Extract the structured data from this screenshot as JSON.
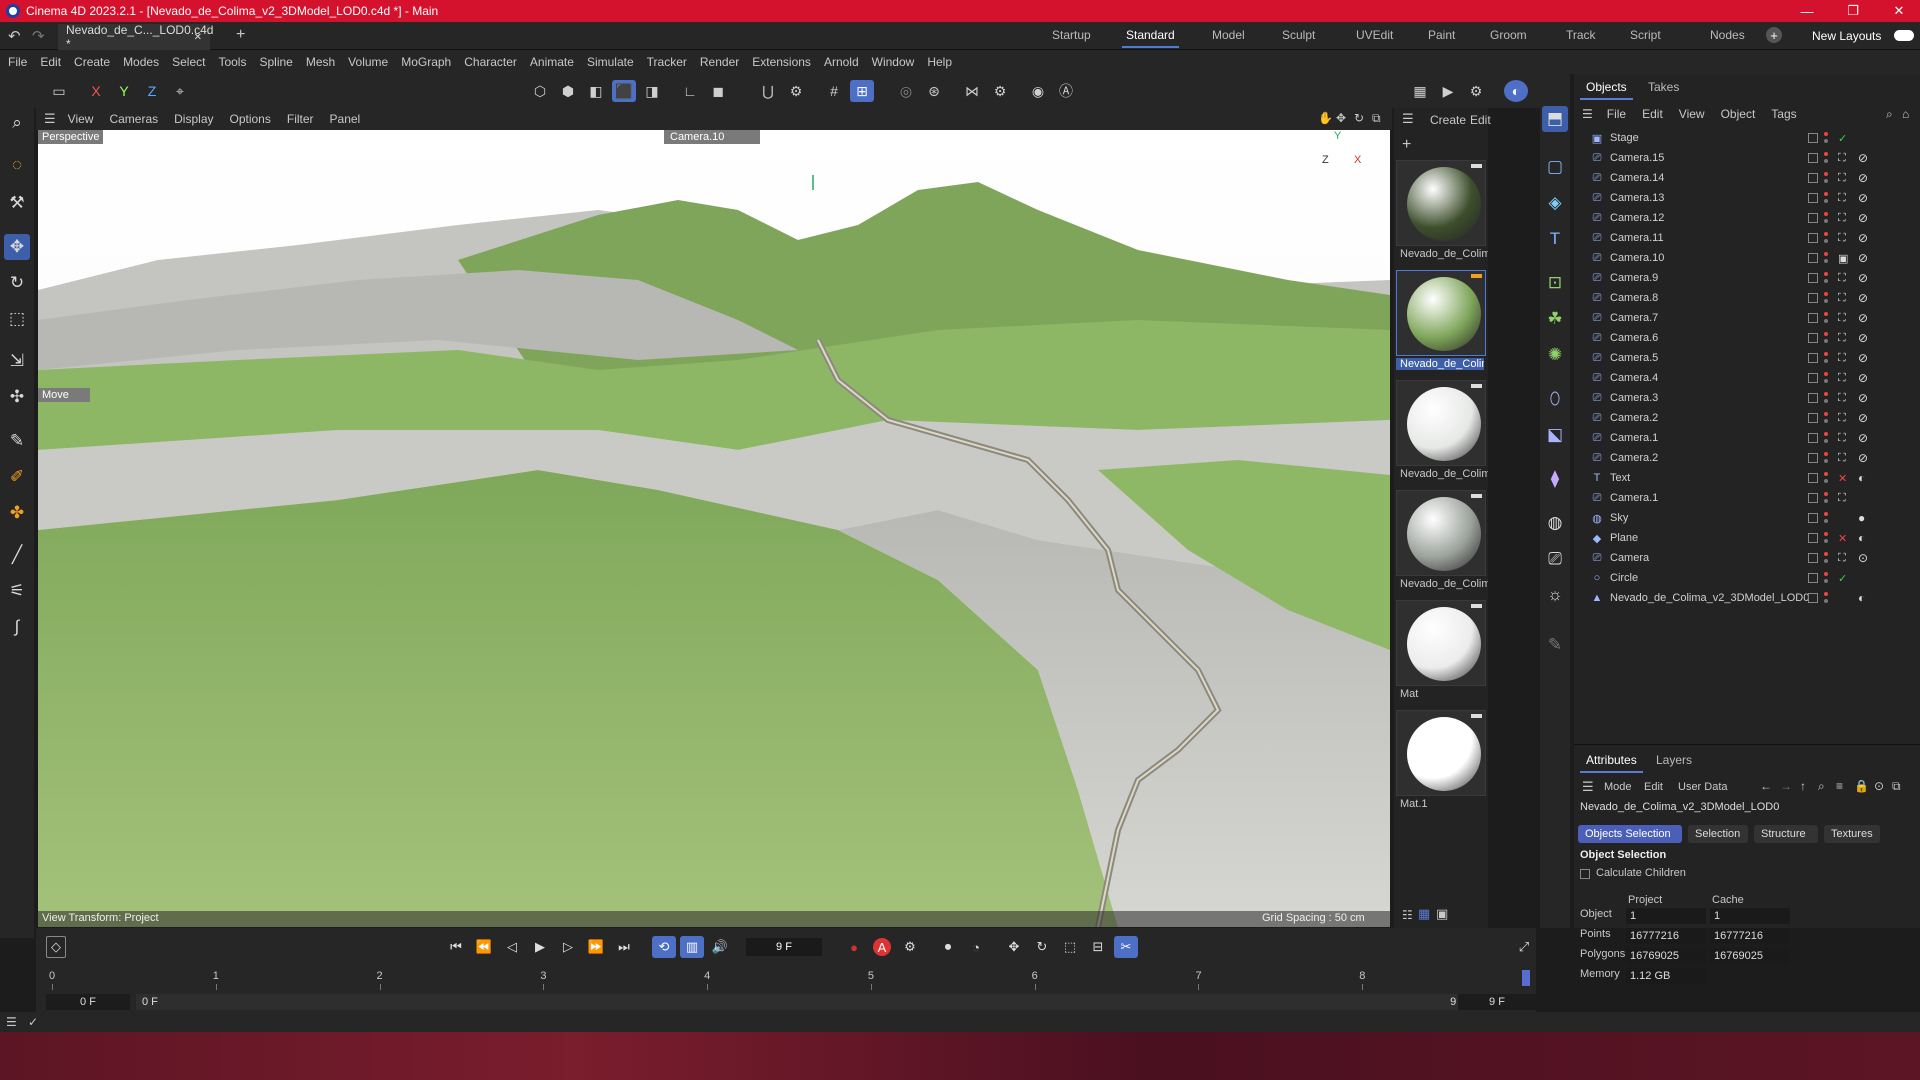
{
  "window": {
    "title": "Cinema 4D 2023.2.1 - [Nevado_de_Colima_v2_3DModel_LOD0.c4d *] - Main",
    "minimize": "—",
    "restore": "❐",
    "close": "✕"
  },
  "doc_tab": {
    "label": "Nevado_de_C..._LOD0.c4d *",
    "close": "✕",
    "add": "+"
  },
  "layouts": [
    "Startup",
    "Standard",
    "Model",
    "Sculpt",
    "UVEdit",
    "Paint",
    "Groom",
    "Track",
    "Script",
    "Nodes"
  ],
  "layouts_active": "Standard",
  "new_layouts": "New Layouts",
  "menu": [
    "File",
    "Edit",
    "Create",
    "Modes",
    "Select",
    "Tools",
    "Spline",
    "Mesh",
    "Volume",
    "MoGraph",
    "Character",
    "Animate",
    "Simulate",
    "Tracker",
    "Render",
    "Extensions",
    "Arnold",
    "Window",
    "Help"
  ],
  "toolbar": {
    "axis_x": "X",
    "axis_y": "Y",
    "axis_z": "Z"
  },
  "viewport": {
    "menu": [
      "View",
      "Cameras",
      "Display",
      "Options",
      "Filter",
      "Panel"
    ],
    "view_name": "Perspective",
    "camera": "Camera.10",
    "tool_hud": "Move",
    "view_transform": "View Transform: Project",
    "grid_spacing": "Grid Spacing : 50 cm",
    "axis_labels": {
      "y": "Y",
      "z": "Z",
      "x": "X"
    }
  },
  "materials": {
    "menu": [
      "Create",
      "Edit"
    ],
    "items": [
      {
        "name": "Nevado_de_Colim",
        "color": "#3d4f2c"
      },
      {
        "name": "Nevado_de_Colim",
        "color": "#7fa55a"
      },
      {
        "name": "Nevado_de_Colim",
        "color": "#e6e8e6"
      },
      {
        "name": "Nevado_de_Colim",
        "color": "#9aa09a"
      },
      {
        "name": "Mat",
        "color": "#ececec"
      },
      {
        "name": "Mat.1",
        "color": "#ffffff"
      }
    ],
    "selected_index": 1
  },
  "objects_panel": {
    "tabs": [
      "Objects",
      "Takes"
    ],
    "menu": [
      "File",
      "Edit",
      "View",
      "Object",
      "Tags"
    ],
    "rows": [
      {
        "name": "Stage",
        "icon": "stage-icon",
        "tag": "✓"
      },
      {
        "name": "Camera.15",
        "icon": "camera-icon",
        "tag": "⛶",
        "tag2": "⊘"
      },
      {
        "name": "Camera.14",
        "icon": "camera-icon",
        "tag": "⛶",
        "tag2": "⊘"
      },
      {
        "name": "Camera.13",
        "icon": "camera-icon",
        "tag": "⛶",
        "tag2": "⊘"
      },
      {
        "name": "Camera.12",
        "icon": "camera-icon",
        "tag": "⛶",
        "tag2": "⊘"
      },
      {
        "name": "Camera.11",
        "icon": "camera-icon",
        "tag": "⛶",
        "tag2": "⊘"
      },
      {
        "name": "Camera.10",
        "icon": "camera-icon",
        "tag": "▣",
        "tag2": "⊘"
      },
      {
        "name": "Camera.9",
        "icon": "camera-icon",
        "tag": "⛶",
        "tag2": "⊘"
      },
      {
        "name": "Camera.8",
        "icon": "camera-icon",
        "tag": "⛶",
        "tag2": "⊘"
      },
      {
        "name": "Camera.7",
        "icon": "camera-icon",
        "tag": "⛶",
        "tag2": "⊘"
      },
      {
        "name": "Camera.6",
        "icon": "camera-icon",
        "tag": "⛶",
        "tag2": "⊘"
      },
      {
        "name": "Camera.5",
        "icon": "camera-icon",
        "tag": "⛶",
        "tag2": "⊘"
      },
      {
        "name": "Camera.4",
        "icon": "camera-icon",
        "tag": "⛶",
        "tag2": "⊘"
      },
      {
        "name": "Camera.3",
        "icon": "camera-icon",
        "tag": "⛶",
        "tag2": "⊘"
      },
      {
        "name": "Camera.2",
        "icon": "camera-icon",
        "tag": "⛶",
        "tag2": "⊘"
      },
      {
        "name": "Camera.1",
        "icon": "camera-icon",
        "tag": "⛶",
        "tag2": "⊘"
      },
      {
        "name": "Camera.2",
        "icon": "camera-icon",
        "tag": "⛶",
        "tag2": "⊘"
      },
      {
        "name": "Text",
        "icon": "text-icon",
        "tag": "✕",
        "tag2": "◐"
      },
      {
        "name": "Camera.1",
        "icon": "camera-icon",
        "tag": "⛶",
        "tag2": ""
      },
      {
        "name": "Sky",
        "icon": "sky-icon",
        "tag": "",
        "tag2": "●"
      },
      {
        "name": "Plane",
        "icon": "plane-icon",
        "tag": "✕",
        "tag2": "◐"
      },
      {
        "name": "Camera",
        "icon": "camera-icon",
        "tag": "⛶",
        "tag2": "⊙"
      },
      {
        "name": "Circle",
        "icon": "circle-icon",
        "tag": "✓",
        "tag2": ""
      },
      {
        "name": "Nevado_de_Colima_v2_3DModel_LOD0",
        "icon": "polygon-icon",
        "tag": "",
        "tag2": "◐"
      }
    ]
  },
  "attributes": {
    "tabs": [
      "Attributes",
      "Layers"
    ],
    "menu": [
      "Mode",
      "Edit",
      "User Data"
    ],
    "object_name": "Nevado_de_Colima_v2_3DModel_LOD0",
    "buttons": [
      "Objects Selection",
      "Selection",
      "Structure",
      "Textures"
    ],
    "section": "Object Selection",
    "calc_children": "Calculate Children",
    "col_project": "Project",
    "col_cache": "Cache",
    "stats": [
      {
        "label": "Object",
        "project": "1",
        "cache": "1"
      },
      {
        "label": "Points",
        "project": "16777216",
        "cache": "16777216"
      },
      {
        "label": "Polygons",
        "project": "16769025",
        "cache": "16769025"
      },
      {
        "label": "Memory",
        "project": "1.12 GB",
        "cache": ""
      }
    ]
  },
  "timeline": {
    "current_frame": "9 F",
    "ticks": [
      "0",
      "1",
      "2",
      "3",
      "4",
      "5",
      "6",
      "7",
      "8"
    ],
    "start": "0 F",
    "min": "0 F",
    "max": "9 F",
    "end": "9 F",
    "playhead_fraction": 1.0
  }
}
